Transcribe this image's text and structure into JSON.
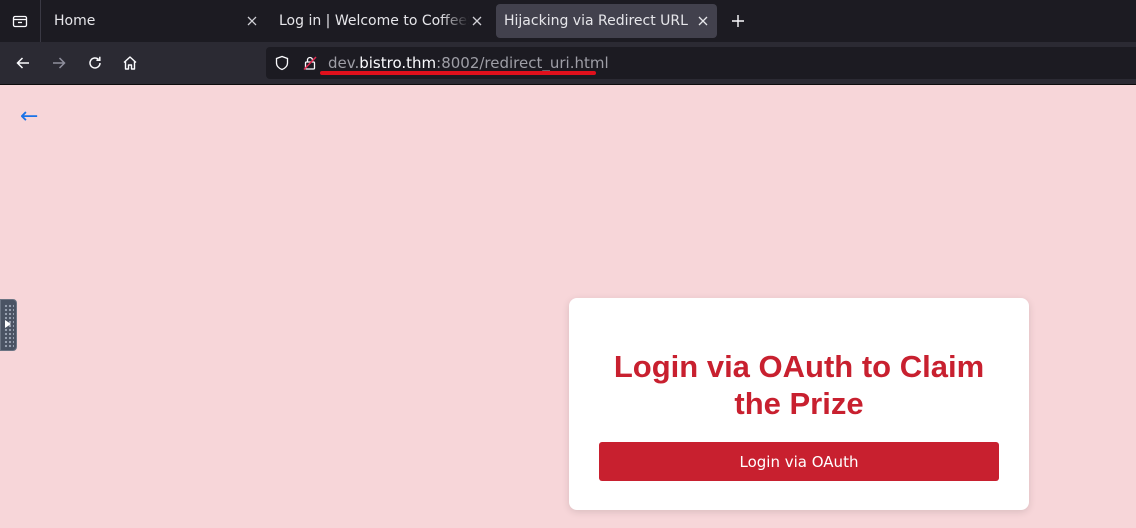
{
  "browser": {
    "tabs": [
      {
        "label": "Home",
        "active": false
      },
      {
        "label": "Log in | Welcome to CoffeeShop",
        "active": false
      },
      {
        "label": "Hijacking via Redirect URL",
        "active": true
      }
    ],
    "url": {
      "prefix": "dev.",
      "host": "bistro.thm",
      "rest": ":8002/redirect_uri.html"
    },
    "icons": [
      "tab-list-icon",
      "close-icon",
      "new-tab-icon",
      "back-icon",
      "forward-icon",
      "reload-icon",
      "home-icon",
      "shield-icon",
      "lock-icon"
    ]
  },
  "page": {
    "back_arrow": "←",
    "card": {
      "title": "Login via OAuth to Claim the Prize",
      "button_label": "Login via OAuth"
    }
  },
  "colors": {
    "page_background": "#f7d6d9",
    "accent_red": "#c8202f",
    "url_highlight_underline": "#e0101c",
    "back_link": "#1a73e8"
  }
}
